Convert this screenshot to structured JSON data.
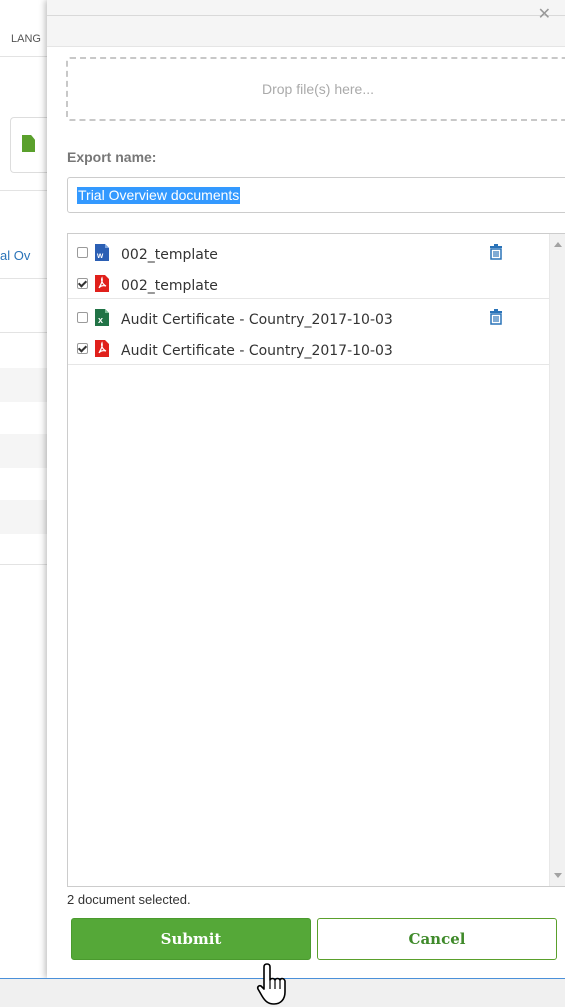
{
  "background": {
    "lang_label": "LANG",
    "trial_link": "al Ov"
  },
  "dropzone": {
    "label": "Drop file(s) here..."
  },
  "export": {
    "label": "Export name:",
    "value": "Trial Overview documents"
  },
  "documents": [
    {
      "rows": [
        {
          "checked": false,
          "icon": "word-file-icon",
          "name": "002_template"
        },
        {
          "checked": true,
          "icon": "pdf-file-icon",
          "name": "002_template"
        }
      ]
    },
    {
      "rows": [
        {
          "checked": false,
          "icon": "excel-file-icon",
          "name": "Audit Certificate - Country_2017-10-03"
        },
        {
          "checked": true,
          "icon": "pdf-file-icon",
          "name": "Audit Certificate - Country_2017-10-03"
        }
      ]
    }
  ],
  "footer": {
    "selected_count": "2 document selected.",
    "submit_label": "Submit",
    "cancel_label": "Cancel"
  },
  "colors": {
    "primary_green": "#55a838",
    "selection_blue": "#3399ff",
    "word_blue": "#2b5fb4",
    "excel_green": "#217346",
    "pdf_red": "#e0201b"
  }
}
